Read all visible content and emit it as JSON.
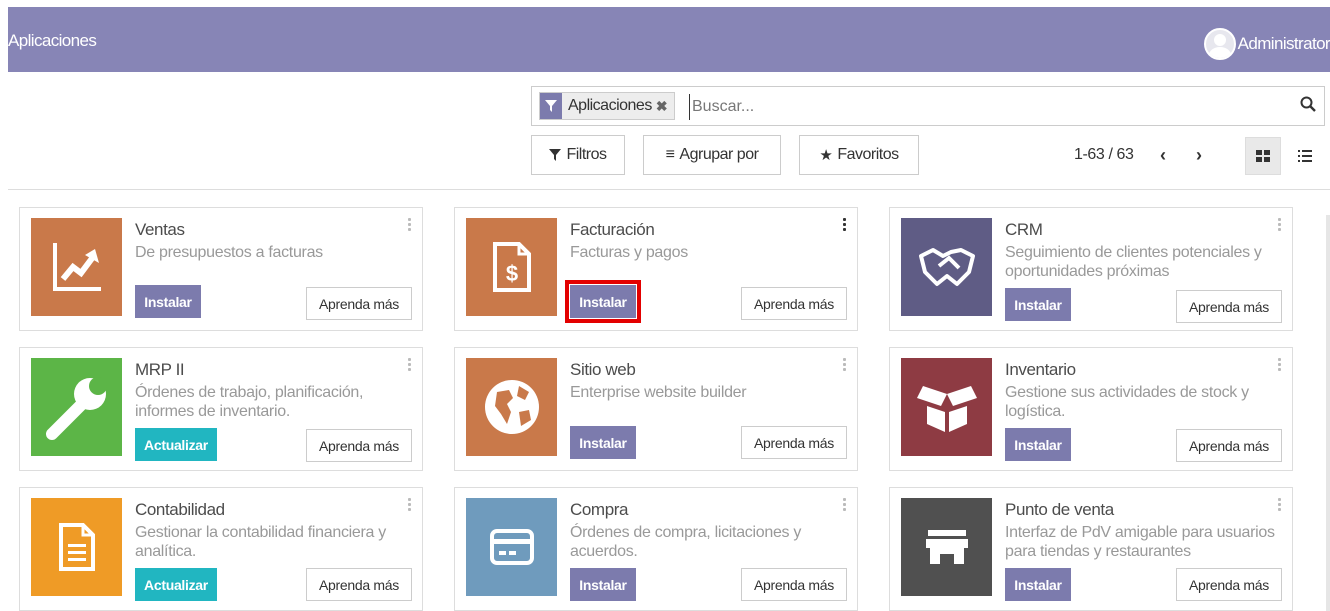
{
  "navbar": {
    "title": "Aplicaciones",
    "user": "Administrator",
    "bg": "#8785b6"
  },
  "search": {
    "facet": "Aplicaciones",
    "placeholder": "Buscar..."
  },
  "toolbar": {
    "filters": "Filtros",
    "group_by": "Agrupar por",
    "favorites": "Favoritos",
    "pager": "1-63 / 63"
  },
  "apps": [
    {
      "name": "Ventas",
      "desc": "De presupuestos a facturas",
      "action": "Instalar",
      "learn": "Aprenda más",
      "icon": "chart-up-icon",
      "color": "#c9794a"
    },
    {
      "name": "Facturación",
      "desc": "Facturas y pagos",
      "action": "Instalar",
      "learn": "Aprenda más",
      "icon": "invoice-dollar-icon",
      "color": "#c9794a"
    },
    {
      "name": "CRM",
      "desc": "Seguimiento de clientes potenciales y oportunidades próximas",
      "action": "Instalar",
      "learn": "Aprenda más",
      "icon": "handshake-icon",
      "color": "#5f5c85"
    },
    {
      "name": "MRP II",
      "desc": "Órdenes de trabajo, planificación, informes de inventario.",
      "action": "Actualizar",
      "learn": "Aprenda más",
      "icon": "wrench-icon",
      "color": "#5cb547"
    },
    {
      "name": "Sitio web",
      "desc": "Enterprise website builder",
      "action": "Instalar",
      "learn": "Aprenda más",
      "icon": "globe-icon",
      "color": "#c9794a"
    },
    {
      "name": "Inventario",
      "desc": "Gestione sus actividades de stock y logística.",
      "action": "Instalar",
      "learn": "Aprenda más",
      "icon": "box-icon",
      "color": "#8e3b43"
    },
    {
      "name": "Contabilidad",
      "desc": "Gestionar la contabilidad financiera y analítica.",
      "action": "Actualizar",
      "learn": "Aprenda más",
      "icon": "document-icon",
      "color": "#ef9b26"
    },
    {
      "name": "Compra",
      "desc": "Órdenes de compra, licitaciones y acuerdos.",
      "action": "Instalar",
      "learn": "Aprenda más",
      "icon": "credit-card-icon",
      "color": "#6f9bbd"
    },
    {
      "name": "Punto de venta",
      "desc": "Interfaz de PdV amigable para usuarios para tiendas y restaurantes",
      "action": "Instalar",
      "learn": "Aprenda más",
      "icon": "store-icon",
      "color": "#505050"
    }
  ]
}
